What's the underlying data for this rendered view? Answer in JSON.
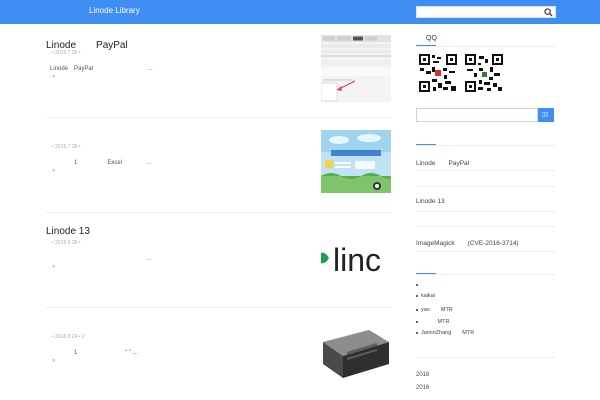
{
  "header": {
    "site_title": "Linode Library",
    "search_placeholder": ""
  },
  "posts": [
    {
      "title": "Linode　　PayPal",
      "meta": "•  2016 7 29  •",
      "excerpt": "Linode　PayPal　　　　　　　　　…",
      "more": "»",
      "thumb": "paypal-screenshot"
    },
    {
      "title": "",
      "meta": "•  2016 7 20  •",
      "excerpt": "　　　　1　　　　　Excel　　　　…",
      "more": "»",
      "thumb": "excel-system"
    },
    {
      "title": "Linode 13",
      "meta": "•  2016 6 29  •",
      "excerpt": "　　　　　　　　　　　　　　　　…",
      "more": "»",
      "thumb": "linode-logo",
      "thumb_text": "linc"
    },
    {
      "title": "",
      "meta": "•  2016 5 24  •  2",
      "excerpt": "　　　　1　　　　　　　　“ ” …",
      "more": "»",
      "thumb": "server-rack"
    }
  ],
  "sidebar": {
    "qq_title": "QQ",
    "search_placeholder": "",
    "search_button": "▯▯",
    "recent_posts": [
      "Linode　　PayPal",
      "Linode 13",
      "ImageMagick　　(CVE-2016-3714)"
    ],
    "comments": [
      "",
      "kaikai",
      "yao　　MTR",
      "　　　MTR",
      "JaminZhang　　MTR"
    ],
    "archives": [
      "2016",
      "2016"
    ]
  },
  "colors": {
    "accent": "#3f8ef3"
  }
}
